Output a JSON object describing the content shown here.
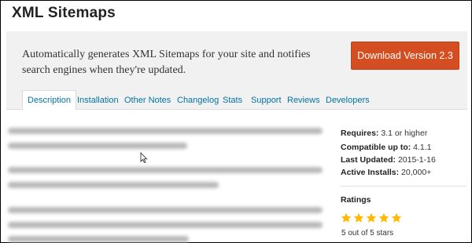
{
  "page": {
    "title": "XML Sitemaps"
  },
  "banner": {
    "description": "Automatically generates XML Sitemaps for your site and notifies search engines when they're updated.",
    "download_label": "Download Version 2.3"
  },
  "tabs": [
    {
      "label": "Description",
      "active": true
    },
    {
      "label": "Installation",
      "active": false
    },
    {
      "label": "Other Notes",
      "active": false
    },
    {
      "label": "Changelog",
      "active": false
    },
    {
      "label": "Stats",
      "active": false
    },
    {
      "label": "Support",
      "active": false
    },
    {
      "label": "Reviews",
      "active": false
    },
    {
      "label": "Developers",
      "active": false
    }
  ],
  "meta": {
    "requires_label": "Requires:",
    "requires_value": "3.1 or higher",
    "compatible_label": "Compatible up to:",
    "compatible_value": "4.1.1",
    "updated_label": "Last Updated:",
    "updated_value": "2015-1-16",
    "installs_label": "Active Installs:",
    "installs_value": "20,000+"
  },
  "ratings": {
    "title": "Ratings",
    "stars": 5,
    "max_stars": 5,
    "summary": "5 out of 5 stars"
  },
  "colors": {
    "accent": "#d54e21",
    "link": "#0074a2",
    "star": "#ffb900"
  }
}
